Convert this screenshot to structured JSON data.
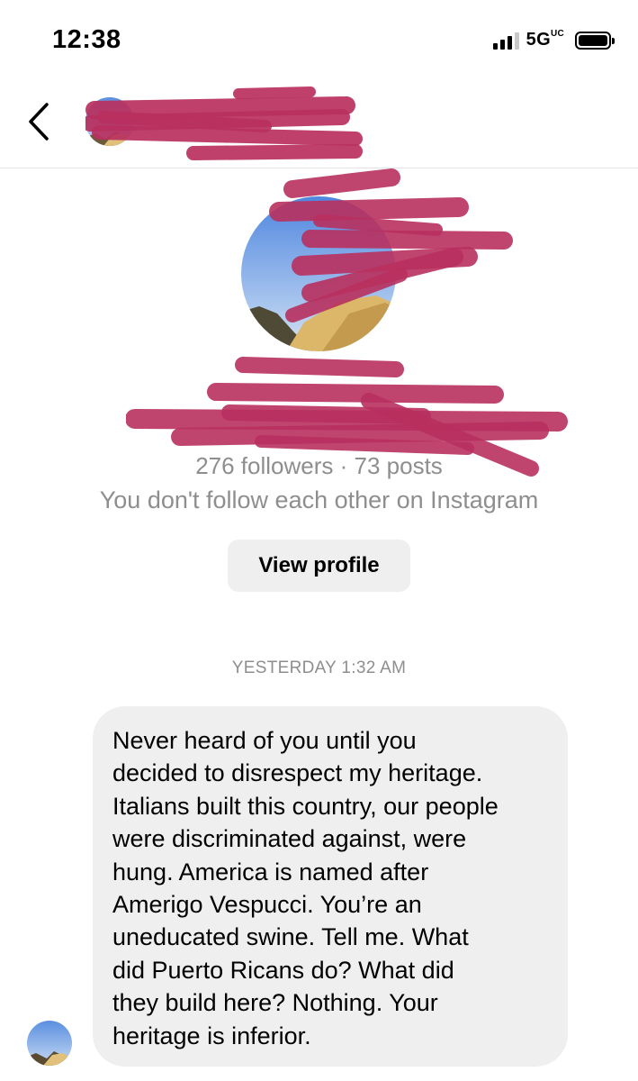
{
  "status_bar": {
    "time": "12:38",
    "network": "5G",
    "network_suffix": "UC",
    "signal_icon": "signal-bars-icon",
    "battery_icon": "battery-icon"
  },
  "header": {
    "back_icon": "chevron-left-icon"
  },
  "profile": {
    "followers_text": "276 followers · 73 posts",
    "follow_status": "You don't follow each other on Instagram",
    "view_profile_label": "View profile"
  },
  "conversation": {
    "timestamp": "YESTERDAY 1:32 AM",
    "message_lines": [
      "Never heard of you until you",
      "decided to disrespect my heritage.",
      "Italians built this country, our people",
      "were discriminated against, were",
      "hung. America is named after",
      "Amerigo Vespucci. You’re an",
      "uneducated swine. Tell me. What",
      "did Puerto Ricans do? What did",
      "they build here? Nothing. Your",
      "heritage is inferior."
    ]
  },
  "colors": {
    "redaction": "#b8305e",
    "bubble": "#efefef",
    "secondary_text": "#8e8e8e"
  }
}
